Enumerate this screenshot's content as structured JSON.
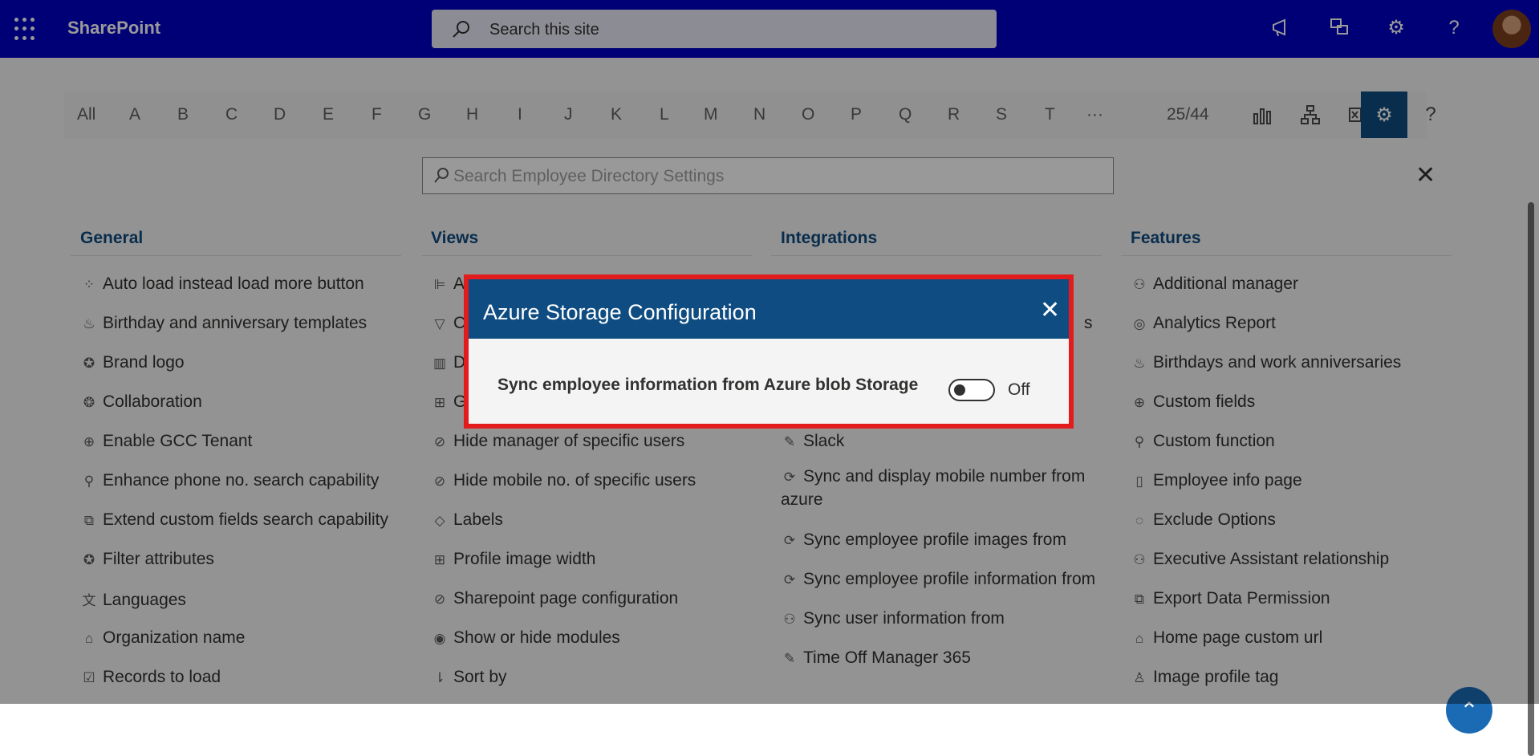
{
  "suite_bar": {
    "app_name": "SharePoint",
    "search_placeholder": "Search this site"
  },
  "alphabet": [
    "All",
    "A",
    "B",
    "C",
    "D",
    "E",
    "F",
    "G",
    "H",
    "I",
    "J",
    "K",
    "L",
    "M",
    "N",
    "O",
    "P",
    "Q",
    "R",
    "S",
    "T",
    "···"
  ],
  "record_count": "25/44",
  "settings_search": {
    "placeholder": "Search Employee Directory Settings"
  },
  "columns": {
    "general": {
      "title": "General",
      "items": [
        "Auto load instead load more button",
        "Birthday and anniversary templates",
        "Brand logo",
        "Collaboration",
        "Enable GCC Tenant",
        "Enhance phone no. search capability",
        "Extend custom fields search capability",
        "Filter attributes",
        "Languages",
        "Organization name",
        "Records to load"
      ]
    },
    "views": {
      "title": "Views",
      "items_partial": [
        "A",
        "C",
        "D",
        "G"
      ],
      "items": [
        "Hide manager of specific users",
        "Hide mobile no. of specific users",
        "Labels",
        "Profile image width",
        "Sharepoint page configuration",
        "Show or hide modules",
        "Sort by"
      ]
    },
    "integrations": {
      "title": "Integrations",
      "items_partial_right": "s",
      "items": [
        "Slack",
        "Sync and display mobile number from azure",
        "Sync employee profile images from",
        "Sync employee profile information from",
        "Sync user information from",
        "Time Off Manager 365"
      ]
    },
    "features": {
      "title": "Features",
      "items": [
        "Additional manager",
        "Analytics Report",
        "Birthdays and work anniversaries",
        "Custom fields",
        "Custom function",
        "Employee info page",
        "Exclude Options",
        "Executive Assistant relationship",
        "Export Data Permission",
        "Home page custom url",
        "Image profile tag"
      ]
    }
  },
  "dialog": {
    "title": "Azure Storage Configuration",
    "setting_label": "Sync employee information from Azure blob Storage",
    "toggle_state": "Off",
    "toggle_on": false
  },
  "colors": {
    "suite_bar": "#0000c5",
    "accent": "#0f4c81",
    "highlight_border": "#e21c1c"
  }
}
